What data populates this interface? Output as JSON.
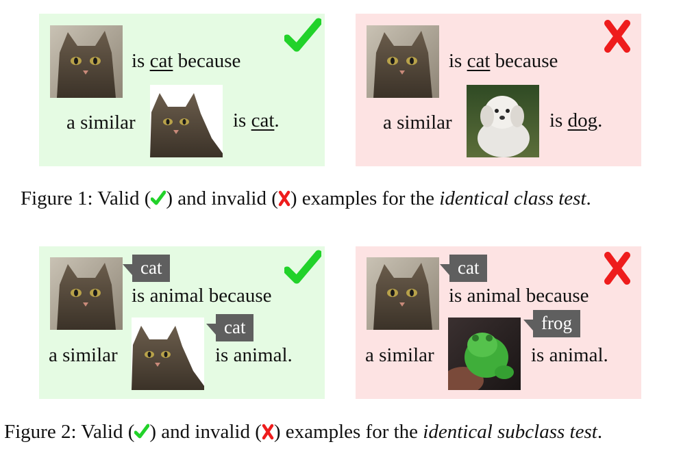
{
  "figure1": {
    "valid": {
      "line1_pre": "is ",
      "line1_word": "cat",
      "line1_post": " because",
      "line2_pre": "a similar",
      "line2_is": "is ",
      "line2_word": "cat",
      "line2_end": "."
    },
    "invalid": {
      "line1_pre": "is ",
      "line1_word": "cat",
      "line1_post": " because",
      "line2_pre": "a similar",
      "line2_is": "is ",
      "line2_word": "dog",
      "line2_end": "."
    },
    "caption": {
      "prefix": "Figure 1: Valid (",
      "mid": ") and invalid (",
      "post": ") examples for the ",
      "italic": "identical class test",
      "end": "."
    }
  },
  "figure2": {
    "valid": {
      "tag1": "cat",
      "line1": "is animal because",
      "tag2": "cat",
      "line2_pre": "a similar",
      "line2_post": "is animal."
    },
    "invalid": {
      "tag1": "cat",
      "line1": "is animal because",
      "tag2": "frog",
      "line2_pre": "a similar",
      "line2_post": "is animal."
    },
    "caption": {
      "prefix": "Figure 2: Valid (",
      "mid": ") and invalid (",
      "post": ") examples for the ",
      "italic": "identical subclass test",
      "end": "."
    }
  },
  "colors": {
    "valid_bg": "#e5fbe3",
    "invalid_bg": "#fde3e3",
    "check": "#22d22a",
    "cross": "#ee1c1c",
    "tag_bg": "#5f5f5f"
  },
  "icons": [
    "check-icon",
    "cross-icon",
    "cat-image",
    "cat-cutout-image",
    "dog-image",
    "frog-image"
  ]
}
